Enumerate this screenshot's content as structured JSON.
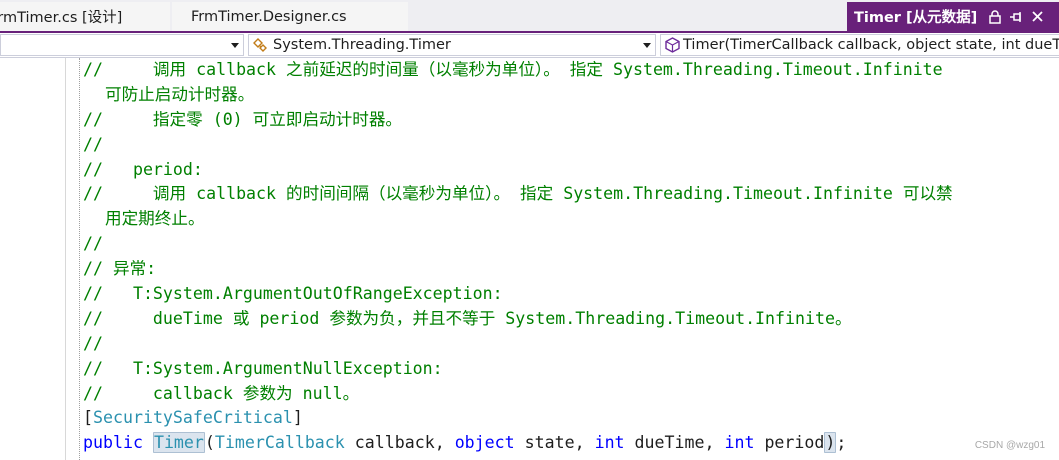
{
  "tabs": {
    "tab1": "FrmTimer.cs [设计]",
    "tab2": "FrmTimer.Designer.cs",
    "active": "Timer [从元数据]"
  },
  "navbar": {
    "project": "",
    "type": "System.Threading.Timer",
    "member": "Timer(TimerCallback callback, object state, int dueTime, int period)"
  },
  "code": {
    "l1": "//     调用 callback 之前延迟的时间量（以毫秒为单位）。 指定 System.Threading.Timeout.Infinite",
    "l2": "可防止启动计时器。",
    "l3": "//     指定零 (0) 可立即启动计时器。",
    "l4": "//",
    "l5": "//   period:",
    "l6": "//     调用 callback 的时间间隔（以毫秒为单位）。 指定 System.Threading.Timeout.Infinite 可以禁",
    "l7": "用定期终止。",
    "l8": "//",
    "l9": "// 异常:",
    "l10": "//   T:System.ArgumentOutOfRangeException:",
    "l11": "//     dueTime 或 period 参数为负，并且不等于 System.Threading.Timeout.Infinite。",
    "l12": "//",
    "l13": "//   T:System.ArgumentNullException:",
    "l14": "//     callback 参数为 null。",
    "attr": {
      "open": "[",
      "name": "SecuritySafeCritical",
      "close": "]"
    },
    "sig": {
      "public": "public",
      "timer": "Timer",
      "paren_open": "(",
      "cb_type": "TimerCallback",
      "cb_name": " callback, ",
      "object": "object",
      "state": " state, ",
      "int1": "int",
      "due": " dueTime, ",
      "int2": "int",
      "period": " period",
      "paren_close": ")",
      "semicolon": ";"
    }
  },
  "watermark": "CSDN @wzg01",
  "colors": {
    "accent": "#68217a",
    "comment": "#008000",
    "keyword": "#0000ff",
    "type": "#2b91af"
  },
  "icons": {
    "lock": "lock-icon",
    "pin": "pin-icon",
    "close": "close-icon",
    "class": "class-icon",
    "method": "method-icon"
  }
}
